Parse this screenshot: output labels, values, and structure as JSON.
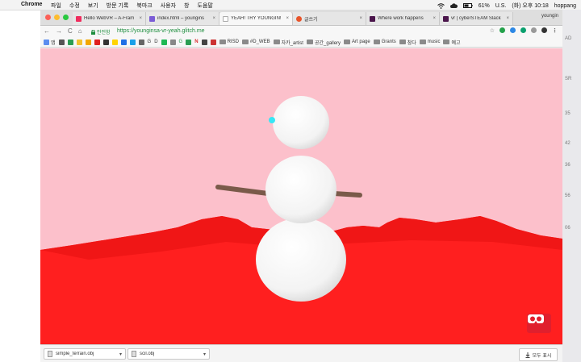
{
  "menubar": {
    "apple": "",
    "app_name": "Chrome",
    "menus": [
      "파일",
      "수정",
      "보기",
      "방문 기록",
      "북마크",
      "사용자",
      "창",
      "도움말"
    ],
    "battery": "61%",
    "input_source": "U.S.",
    "clock": "(화) 오후 10:18",
    "user": "hoppang"
  },
  "tabs": [
    {
      "title": "Hello WebVR – A-Fram",
      "favicon_color": "#ef2d5e",
      "close": "×"
    },
    {
      "title": "index.html – youngins",
      "favicon_color": "#7b5cd6",
      "close": "×"
    },
    {
      "title": "YEAH! TRY YOUNGIN!",
      "favicon_color": "#ffffff",
      "close": "×"
    },
    {
      "title": "글쓰기",
      "favicon_color": "#e8542a",
      "close": "×"
    },
    {
      "title": "Where work happens",
      "favicon_color": "#4a154b",
      "close": "×"
    },
    {
      "title": "vr | cyberSTEAM Slack",
      "favicon_color": "#4a154b",
      "close": "×"
    }
  ],
  "tab_user": "youngin",
  "toolbar": {
    "back": "←",
    "forward": "→",
    "reload": "C",
    "home": "⌂",
    "secure_label": "안전함",
    "url": "https://younginsa-vr-yeah.glitch.me",
    "star": "☆"
  },
  "bookmarks": {
    "apps_label": "앱",
    "folders": [
      "RISD",
      "#D_WEB",
      "자카_artist",
      "공간_gallery",
      "Art page",
      "Grants",
      "참다",
      "music",
      "예고"
    ],
    "icon_letters": [
      "G",
      "D",
      "G",
      "N"
    ]
  },
  "scene": {
    "sky_color": "#fcc0cb",
    "ground_color": "#ff1f1f",
    "snowman_color": "#ffffff",
    "arm_color": "#7a5a4a",
    "eye_color": "#37e6f5"
  },
  "vr_button": {
    "label": "Enter VR"
  },
  "downloads": [
    {
      "name": "simple_terrain.obj",
      "caret": "▾"
    },
    {
      "name": "scil.obj",
      "caret": "▾"
    }
  ],
  "show_all": "모두 표시",
  "desktop": {
    "labels": [
      "AD",
      "SR",
      "35",
      "42",
      "36",
      "56",
      "06"
    ]
  }
}
